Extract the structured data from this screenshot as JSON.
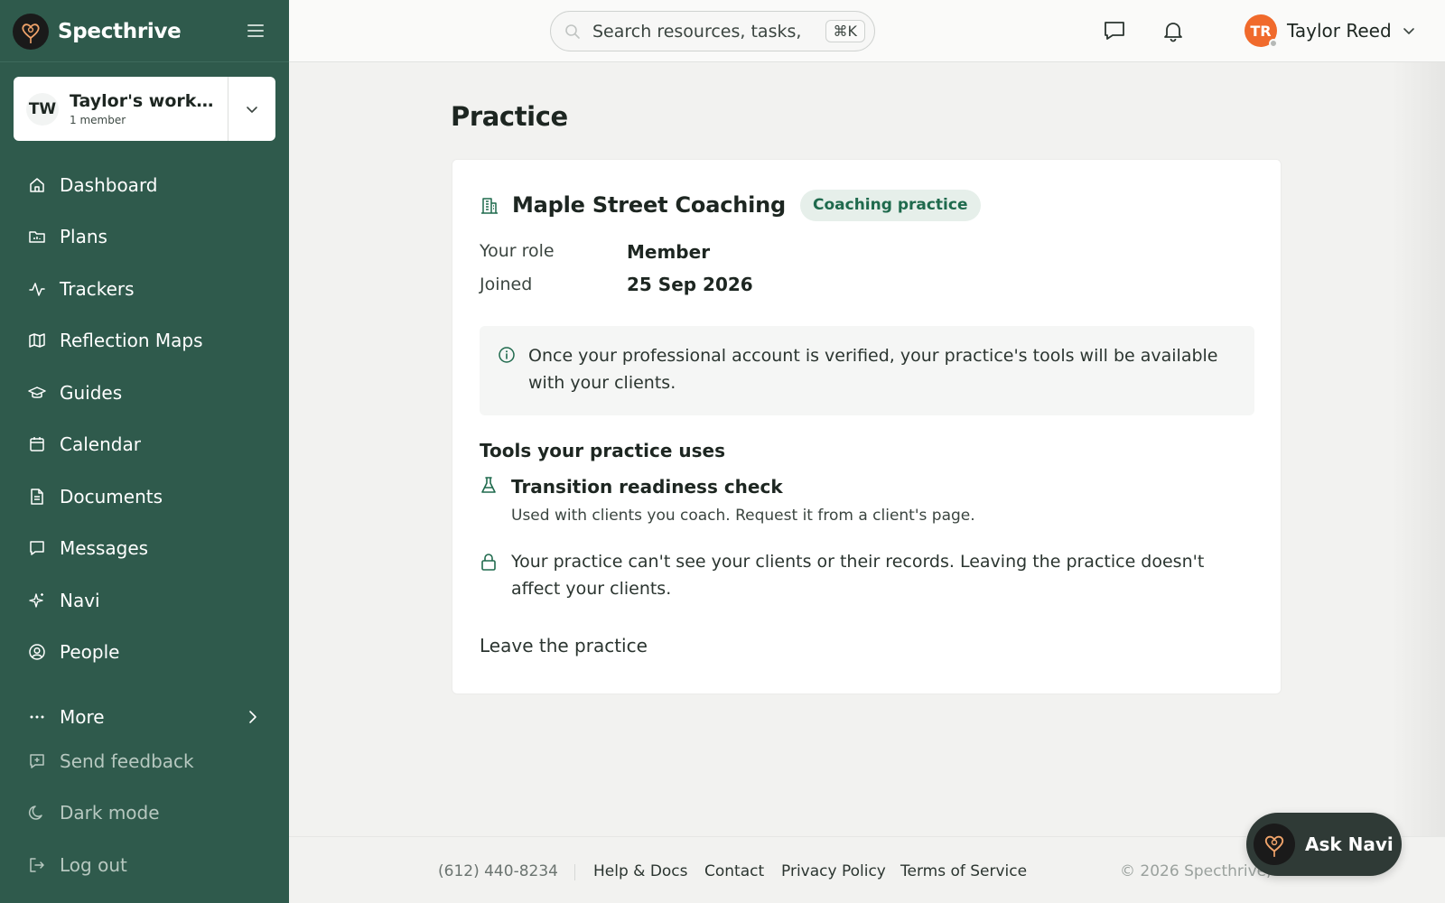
{
  "colors": {
    "sidebar": "#2f5a4c",
    "accent": "#1f6a4d",
    "badge_bg": "#e6efea",
    "avatar": "#f06a2c"
  },
  "brand": {
    "name": "Specthrive",
    "icon": "heart-balloon-logo-icon"
  },
  "workspace": {
    "initials": "TW",
    "name": "Taylor's works...",
    "members": "1 member"
  },
  "nav": [
    {
      "label": "Dashboard",
      "icon": "home-icon"
    },
    {
      "label": "Plans",
      "icon": "folder-chart-icon"
    },
    {
      "label": "Trackers",
      "icon": "activity-icon"
    },
    {
      "label": "Reflection Maps",
      "icon": "map-icon"
    },
    {
      "label": "Guides",
      "icon": "graduation-cap-icon"
    },
    {
      "label": "Calendar",
      "icon": "calendar-icon"
    },
    {
      "label": "Documents",
      "icon": "document-icon"
    },
    {
      "label": "Messages",
      "icon": "chat-bubble-icon"
    },
    {
      "label": "Navi",
      "icon": "sparkles-icon"
    },
    {
      "label": "People",
      "icon": "user-circle-icon"
    }
  ],
  "more": {
    "label": "More"
  },
  "secondary": [
    {
      "label": "Send feedback",
      "icon": "feedback-icon"
    },
    {
      "label": "Dark mode",
      "icon": "moon-icon"
    },
    {
      "label": "Log out",
      "icon": "logout-icon"
    }
  ],
  "topbar": {
    "search_text": "Search resources, tasks,",
    "shortcut": "⌘K",
    "user_initials": "TR",
    "user_name": "Taylor Reed"
  },
  "page": {
    "title": "Practice"
  },
  "practice": {
    "name": "Maple Street Coaching",
    "badge": "Coaching practice",
    "role_label": "Your role",
    "role_value": "Member",
    "joined_label": "Joined",
    "joined_value": "25 Sep 2026",
    "info_text": "Once your professional account is verified, your practice's tools will be available with your clients.",
    "tools_title": "Tools your practice uses",
    "tool_name": "Transition readiness check",
    "tool_desc": "Used with clients you coach. Request it from a client's page.",
    "privacy_text": "Your practice can't see your clients or their records. Leaving the practice doesn't affect your clients.",
    "leave_label": "Leave the practice"
  },
  "footer": {
    "phone": "(612) 440-8234",
    "links": [
      "Help & Docs",
      "Contact",
      "Privacy Policy",
      "Terms of Service"
    ],
    "copyright": "© 2026 Specthrive, Inc."
  },
  "ask_navi": {
    "label": "Ask Navi"
  }
}
